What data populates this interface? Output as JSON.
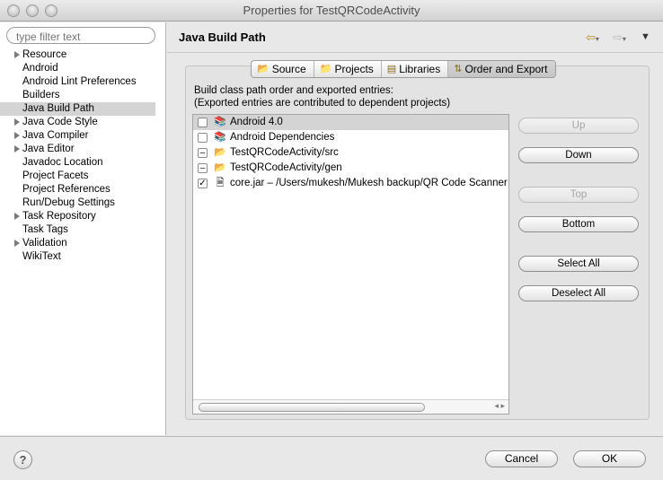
{
  "window": {
    "title": "Properties for TestQRCodeActivity"
  },
  "filter": {
    "placeholder": "type filter text"
  },
  "tree": [
    {
      "label": "Resource",
      "expandable": true
    },
    {
      "label": "Android",
      "expandable": false
    },
    {
      "label": "Android Lint Preferences",
      "expandable": false
    },
    {
      "label": "Builders",
      "expandable": false
    },
    {
      "label": "Java Build Path",
      "expandable": false,
      "selected": true
    },
    {
      "label": "Java Code Style",
      "expandable": true
    },
    {
      "label": "Java Compiler",
      "expandable": true
    },
    {
      "label": "Java Editor",
      "expandable": true
    },
    {
      "label": "Javadoc Location",
      "expandable": false
    },
    {
      "label": "Project Facets",
      "expandable": false
    },
    {
      "label": "Project References",
      "expandable": false
    },
    {
      "label": "Run/Debug Settings",
      "expandable": false
    },
    {
      "label": "Task Repository",
      "expandable": true
    },
    {
      "label": "Task Tags",
      "expandable": false
    },
    {
      "label": "Validation",
      "expandable": true
    },
    {
      "label": "WikiText",
      "expandable": false
    }
  ],
  "page": {
    "title": "Java Build Path"
  },
  "tabs": [
    {
      "label": "Source",
      "icon": "source-folder-icon"
    },
    {
      "label": "Projects",
      "icon": "projects-icon"
    },
    {
      "label": "Libraries",
      "icon": "libraries-icon"
    },
    {
      "label": "Order and Export",
      "icon": "order-export-icon",
      "active": true
    }
  ],
  "description": {
    "line1": "Build class path order and exported entries:",
    "line2": "(Exported entries are contributed to dependent projects)"
  },
  "entries": [
    {
      "label": "Android 4.0",
      "check": "unchecked",
      "icon": "library-icon",
      "selected": true
    },
    {
      "label": "Android Dependencies",
      "check": "unchecked",
      "icon": "library-icon"
    },
    {
      "label": "TestQRCodeActivity/src",
      "check": "mixed",
      "icon": "folder-icon"
    },
    {
      "label": "TestQRCodeActivity/gen",
      "check": "mixed",
      "icon": "folder-icon"
    },
    {
      "label": "core.jar – /Users/mukesh/Mukesh backup/QR Code Scanner",
      "check": "checked",
      "icon": "jar-icon"
    }
  ],
  "buttons": {
    "up": "Up",
    "down": "Down",
    "top": "Top",
    "bottom": "Bottom",
    "select_all": "Select All",
    "deselect_all": "Deselect All"
  },
  "dialog": {
    "cancel": "Cancel",
    "ok": "OK",
    "help": "?"
  }
}
